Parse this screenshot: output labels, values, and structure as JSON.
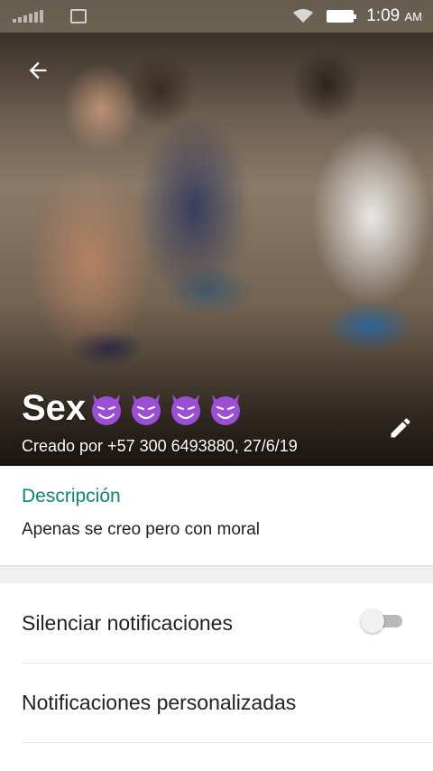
{
  "status_bar": {
    "time": "1:09",
    "time_suffix": "AM",
    "signal_icon": "signal-icon",
    "image_icon": "image-notification-icon",
    "wifi_icon": "wifi-icon",
    "battery_icon": "battery-icon"
  },
  "header": {
    "back_icon": "arrow-back-icon",
    "group_name": "Sex",
    "group_emoji": [
      "😈",
      "😈",
      "😈",
      "😈"
    ],
    "created_by": "Creado por +57 300 6493880, 27/6/19",
    "edit_icon": "pencil-icon"
  },
  "description": {
    "title": "Descripción",
    "text": "Apenas se creo pero con moral"
  },
  "settings": {
    "mute_label": "Silenciar notificaciones",
    "mute_enabled": false,
    "custom_notifications_label": "Notificaciones personalizadas"
  },
  "colors": {
    "accent": "#07897a",
    "emoji_purple": "#9b4fd6"
  }
}
